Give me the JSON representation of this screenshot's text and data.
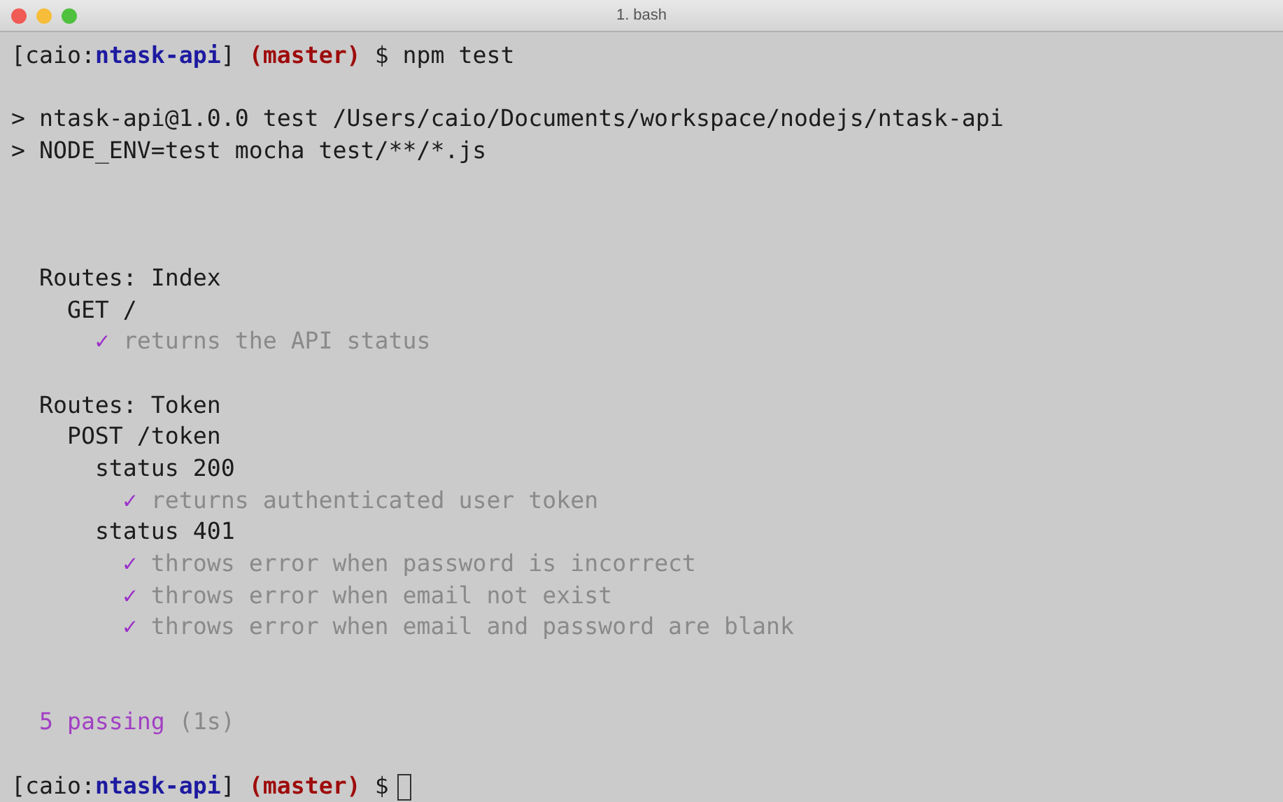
{
  "window": {
    "title": "1. bash"
  },
  "first_prompt": {
    "segments": [
      {
        "kind": "plain",
        "text": "[caio:"
      },
      {
        "kind": "directory",
        "text": "ntask-api"
      },
      {
        "kind": "plain",
        "text": "]"
      },
      {
        "kind": "branch",
        "text": "(master)"
      },
      {
        "kind": "plain",
        "text": "$ npm test"
      }
    ]
  },
  "script_lines": [
    "> ntask-api@1.0.0 test /Users/caio/Documents/workspace/nodejs/ntask-api",
    "> NODE_ENV=test mocha test/**/*.js"
  ],
  "suites": [
    {
      "kind": "suite",
      "title": "Routes: Index",
      "children": [
        {
          "kind": "suite",
          "title": "GET /",
          "children": [
            {
              "kind": "test",
              "mark": "✓",
              "title": "returns the API status"
            }
          ]
        }
      ]
    },
    {
      "kind": "suite",
      "title": "Routes: Token",
      "children": [
        {
          "kind": "suite",
          "title": "POST /token",
          "children": [
            {
              "kind": "suite",
              "title": "status 200",
              "children": [
                {
                  "kind": "test",
                  "mark": "✓",
                  "title": "returns authenticated user token"
                }
              ]
            },
            {
              "kind": "suite",
              "title": "status 401",
              "children": [
                {
                  "kind": "test",
                  "mark": "✓",
                  "title": "throws error when password is incorrect"
                },
                {
                  "kind": "test",
                  "mark": "✓",
                  "title": "throws error when email not exist"
                },
                {
                  "kind": "test",
                  "mark": "✓",
                  "title": "throws error when email and password are blank"
                }
              ]
            }
          ]
        }
      ]
    }
  ],
  "summary": {
    "passing": "5 passing",
    "duration": "(1s)"
  },
  "last_prompt": {
    "segments": [
      {
        "kind": "plain",
        "text": "[caio:"
      },
      {
        "kind": "directory",
        "text": "ntask-api"
      },
      {
        "kind": "plain",
        "text": "]"
      },
      {
        "kind": "branch",
        "text": "(master)"
      },
      {
        "kind": "plain",
        "text": "$"
      }
    ],
    "cursor": true
  }
}
